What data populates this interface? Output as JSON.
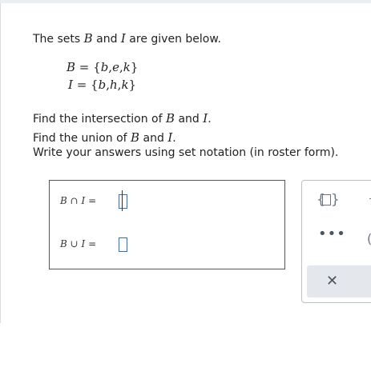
{
  "intro": {
    "pre": "The sets ",
    "set1": "B",
    "mid": " and ",
    "set2": "I",
    "post": " are given below."
  },
  "sets": {
    "B": {
      "name": "B",
      "eq": " = ",
      "open": "{",
      "elements": [
        "b",
        "e",
        "k"
      ],
      "sep": ",",
      "close": "}"
    },
    "I": {
      "name": "I",
      "eq": " = ",
      "open": "{",
      "elements": [
        "b",
        "h",
        "k"
      ],
      "sep": ",",
      "close": "}"
    }
  },
  "questions": {
    "q1": {
      "pre": "Find the intersection of ",
      "a": "B",
      "mid": " and ",
      "b": "I",
      "post": "."
    },
    "q2": {
      "pre": "Find the union of ",
      "a": "B",
      "mid": " and ",
      "b": "I",
      "post": "."
    },
    "q3": "Write your answers using set notation (in roster form)."
  },
  "answers": {
    "intersection": {
      "a": "B",
      "op": " ∩ ",
      "b": "I",
      "eq": " =",
      "value": ""
    },
    "union": {
      "a": "B",
      "op": " ∪ ",
      "b": "I",
      "eq": " =",
      "value": ""
    }
  },
  "toolbar": {
    "set_template_icon": "set-braces-icon",
    "more_label": "•••",
    "clear_label": "✕",
    "partial_paren": "(",
    "partial_mark": "\\"
  }
}
